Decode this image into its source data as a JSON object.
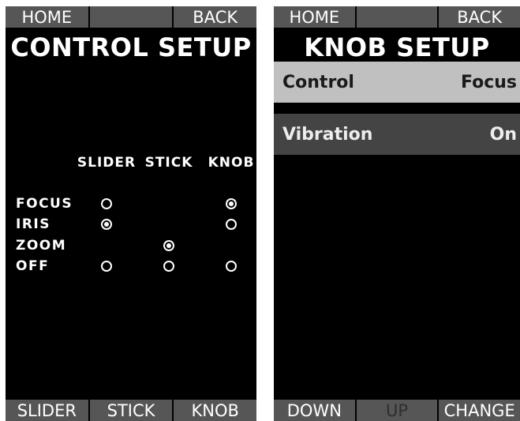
{
  "left": {
    "top_keys": [
      "HOME",
      "",
      "BACK"
    ],
    "title": "CONTROL SETUP",
    "columns": [
      "SLIDER",
      "STICK",
      "KNOB"
    ],
    "rows": [
      {
        "label": "FOCUS",
        "options": [
          "off",
          "none",
          "on"
        ]
      },
      {
        "label": "IRIS",
        "options": [
          "on",
          "none",
          "off"
        ]
      },
      {
        "label": "ZOOM",
        "options": [
          "none",
          "on",
          "none"
        ]
      },
      {
        "label": "OFF",
        "options": [
          "off",
          "off",
          "off"
        ]
      }
    ],
    "bottom_keys": [
      "SLIDER",
      "STICK",
      "KNOB"
    ]
  },
  "right": {
    "top_keys": [
      "HOME",
      "",
      "BACK"
    ],
    "title": "KNOB SETUP",
    "menu": [
      {
        "label": "Control",
        "value": "Focus",
        "selected": true
      },
      {
        "label": "Vibration",
        "value": "On",
        "selected": false
      }
    ],
    "bottom_keys": [
      {
        "label": "DOWN",
        "enabled": true
      },
      {
        "label": "UP",
        "enabled": false
      },
      {
        "label": "CHANGE",
        "enabled": true
      }
    ]
  },
  "colors": {
    "screen_bg": "#000000",
    "softkey_bg": "#565656",
    "selected_row_bg": "#c0c0c0",
    "normal_row_bg": "#444444"
  }
}
